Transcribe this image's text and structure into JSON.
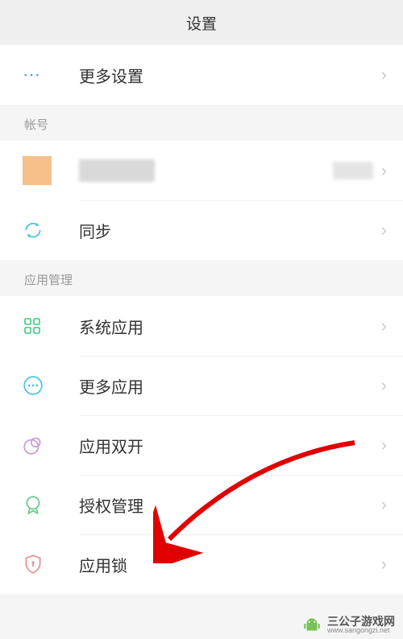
{
  "header": {
    "title": "设置"
  },
  "rows": {
    "more_settings": "更多设置",
    "sync": "同步",
    "system_apps": "系统应用",
    "more_apps": "更多应用",
    "dual_apps": "应用双开",
    "permissions": "授权管理",
    "app_lock": "应用锁"
  },
  "section_headers": {
    "account": "帐号",
    "app_mgmt": "应用管理"
  },
  "watermark": {
    "name": "三公子游戏网",
    "url": "www.sangongzi.net"
  }
}
